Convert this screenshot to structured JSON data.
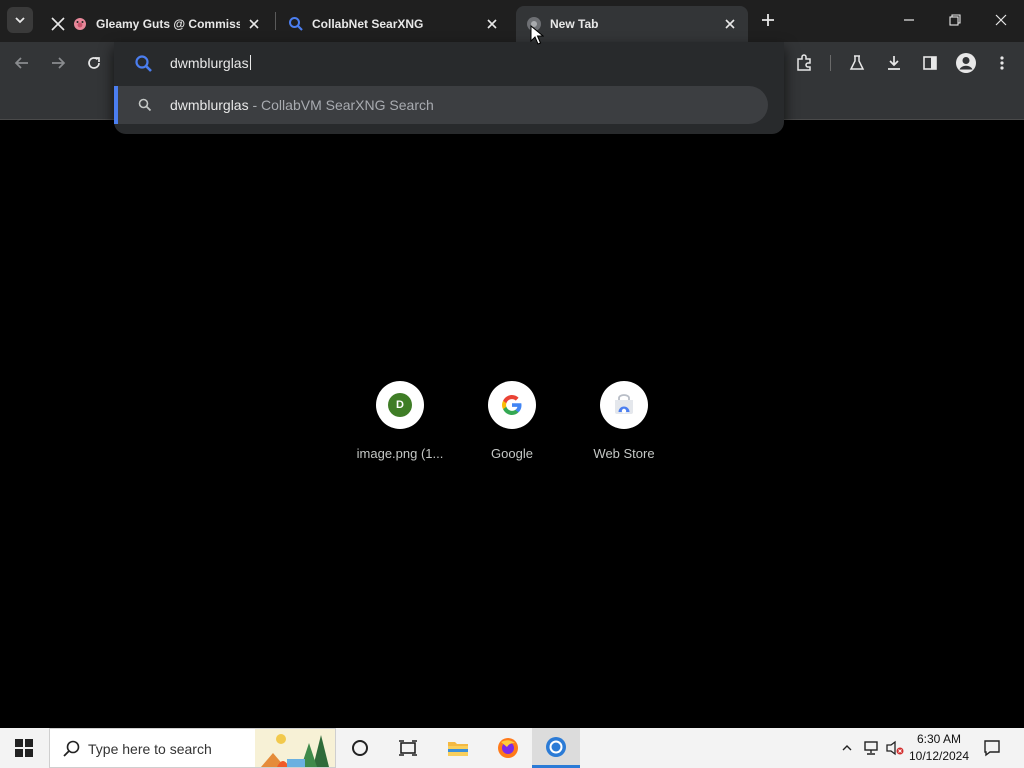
{
  "tabs": [
    {
      "title": "Gleamy Guts @ Commissio",
      "favicon": "x-logo-icon",
      "close": "×"
    },
    {
      "title": "CollabNet SearXNG",
      "favicon": "search-icon",
      "close": "×"
    },
    {
      "title": "New Tab",
      "favicon": "globe-icon",
      "close": "×",
      "active": true
    }
  ],
  "omnibox": {
    "query": "dwmblurglas",
    "suggestion": {
      "query": "dwmblurglas",
      "description": " - CollabVM SearXNG Search"
    }
  },
  "shortcuts": [
    {
      "label": "image.png (1...",
      "icon": "d-letter-icon",
      "letter": "D"
    },
    {
      "label": "Google",
      "icon": "google-g-icon"
    },
    {
      "label": "Web Store",
      "icon": "web-store-icon"
    }
  ],
  "taskbar": {
    "search_placeholder": "Type here to search",
    "time": "6:30 AM",
    "date": "10/12/2024"
  },
  "colors": {
    "accent": "#4b7ef0",
    "tab_strip": "#1f1f1f",
    "toolbar": "#333537",
    "page_bg": "#000000"
  }
}
